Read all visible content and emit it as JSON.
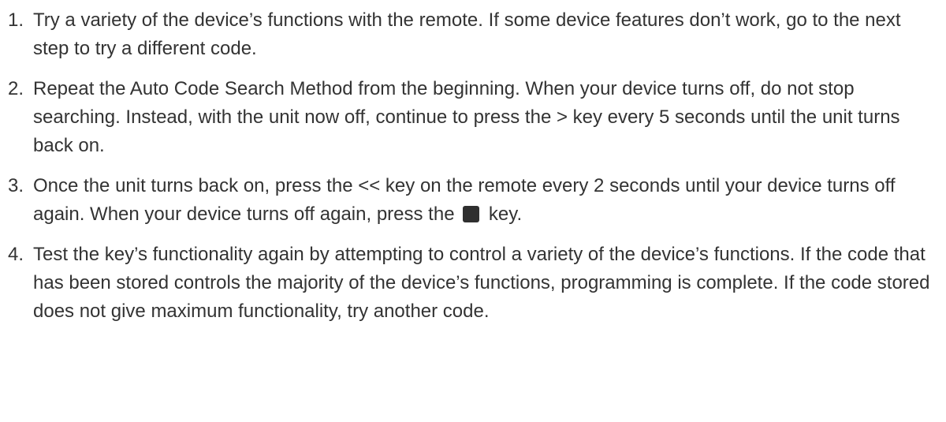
{
  "steps": [
    {
      "number": "1.",
      "text": "Try a variety of the device’s functions with the remote. If some device features don’t work, go to the next step to try a different code."
    },
    {
      "number": "2.",
      "text": "Repeat the Auto Code Search Method from the beginning. When your device turns off, do not stop searching. Instead, with the unit now off, continue to press the > key every 5 seconds until the unit turns back on."
    },
    {
      "number": "3.",
      "text_before_icon": "Once the unit turns back on, press the << key on the remote every 2 seconds until your device turns off again. When your device turns off again, press the",
      "icon": "stop-key-icon",
      "text_after_icon": "key."
    },
    {
      "number": "4.",
      "text": "Test the key’s functionality again by attempting to control a variety of the device’s functions. If the code that has been stored controls the majority of the device’s functions, programming is complete. If the code stored does not give maximum functionality, try another code."
    }
  ]
}
